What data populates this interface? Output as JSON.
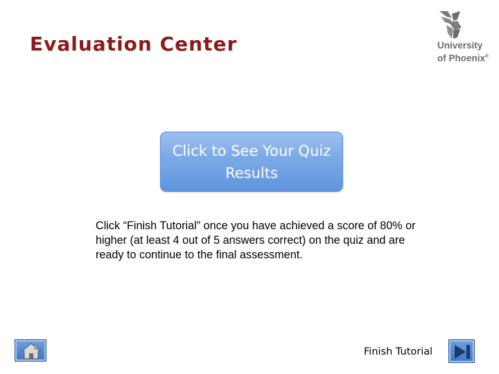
{
  "header": {
    "title": "Evaluation Center"
  },
  "logo": {
    "line1": "University",
    "line2": "of Phoenix",
    "mark": "®",
    "icon": "phoenix-bird-icon",
    "text_color": "#6b6b6b"
  },
  "main": {
    "quiz_button_label": "Click to See Your Quiz Results",
    "instructions": "Click “Finish Tutorial” once you have achieved a score of 80% or higher (at least 4 out of 5 answers correct) on the quiz and are ready to continue to the final assessment."
  },
  "footer": {
    "home_icon": "home-icon",
    "finish_label": "Finish Tutorial",
    "end_icon": "skip-to-end-icon"
  },
  "colors": {
    "title": "#8b1a1a",
    "button_blue": "#7aa9e6",
    "nav_blue": "#3d74c4"
  }
}
